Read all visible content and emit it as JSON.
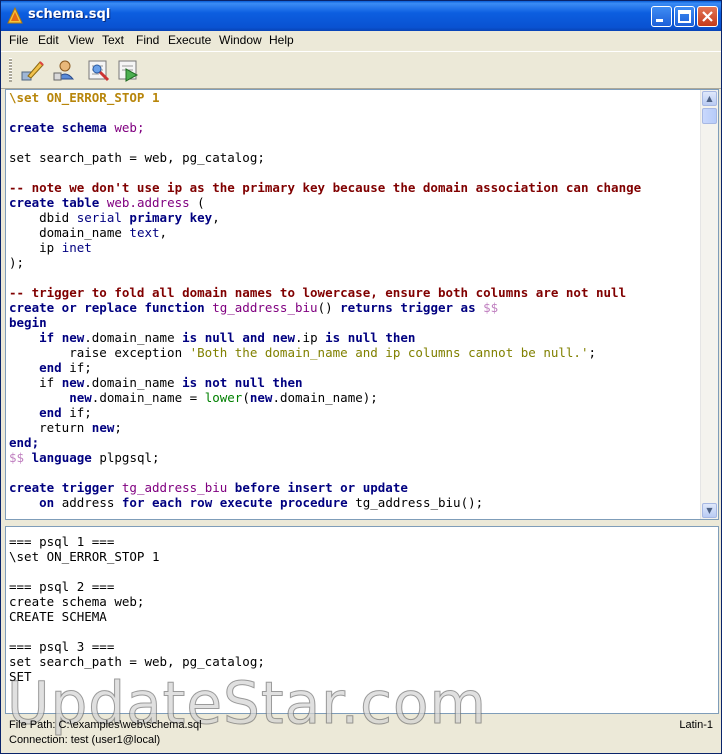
{
  "window": {
    "title": "schema.sql"
  },
  "menu": [
    "File",
    "Edit",
    "View",
    "Text",
    "Find",
    "Execute",
    "Window",
    "Help"
  ],
  "toolbar": {
    "icons": [
      "edit-pencil-icon",
      "connect-icon",
      "execute-icon",
      "execute-stop-icon"
    ]
  },
  "editor": {
    "lines": [
      [
        {
          "t": "\\set ON_ERROR_STOP 1",
          "c": "dir"
        }
      ],
      [],
      [
        {
          "t": "create",
          "c": "kw"
        },
        {
          "t": " "
        },
        {
          "t": "schema",
          "c": "kw"
        },
        {
          "t": " "
        },
        {
          "t": "web;",
          "c": "id"
        }
      ],
      [],
      [
        {
          "t": "set search_path = web, pg_catalog;"
        }
      ],
      [],
      [
        {
          "t": "-- note we don't use ip as the primary key because the domain association can change",
          "c": "cm"
        }
      ],
      [
        {
          "t": "create",
          "c": "kw"
        },
        {
          "t": " "
        },
        {
          "t": "table",
          "c": "kw"
        },
        {
          "t": " "
        },
        {
          "t": "web.address",
          "c": "id"
        },
        {
          "t": " ("
        }
      ],
      [
        {
          "t": "    dbid "
        },
        {
          "t": "serial",
          "c": "ty"
        },
        {
          "t": " "
        },
        {
          "t": "primary key",
          "c": "kw"
        },
        {
          "t": ","
        }
      ],
      [
        {
          "t": "    domain_name "
        },
        {
          "t": "text",
          "c": "ty"
        },
        {
          "t": ","
        }
      ],
      [
        {
          "t": "    ip "
        },
        {
          "t": "inet",
          "c": "ty"
        }
      ],
      [
        {
          "t": ");"
        }
      ],
      [],
      [
        {
          "t": "-- trigger to fold all domain names to lowercase, ensure both columns are not null",
          "c": "cm"
        }
      ],
      [
        {
          "t": "create or replace function",
          "c": "kw"
        },
        {
          "t": " "
        },
        {
          "t": "tg_address_biu",
          "c": "id"
        },
        {
          "t": "() "
        },
        {
          "t": "returns trigger as",
          "c": "kw"
        },
        {
          "t": " "
        },
        {
          "t": "$$",
          "c": "dol"
        }
      ],
      [
        {
          "t": "begin",
          "c": "kw"
        }
      ],
      [
        {
          "t": "    "
        },
        {
          "t": "if",
          "c": "kw"
        },
        {
          "t": " "
        },
        {
          "t": "new",
          "c": "kw"
        },
        {
          "t": ".domain_name "
        },
        {
          "t": "is null and",
          "c": "kw"
        },
        {
          "t": " "
        },
        {
          "t": "new",
          "c": "kw"
        },
        {
          "t": ".ip "
        },
        {
          "t": "is null then",
          "c": "kw"
        }
      ],
      [
        {
          "t": "        raise exception "
        },
        {
          "t": "'Both the domain_name and ip columns cannot be null.'",
          "c": "st"
        },
        {
          "t": ";"
        }
      ],
      [
        {
          "t": "    "
        },
        {
          "t": "end",
          "c": "kw"
        },
        {
          "t": " if;"
        }
      ],
      [
        {
          "t": "    if "
        },
        {
          "t": "new",
          "c": "kw"
        },
        {
          "t": ".domain_name "
        },
        {
          "t": "is not null then",
          "c": "kw"
        }
      ],
      [
        {
          "t": "        "
        },
        {
          "t": "new",
          "c": "kw"
        },
        {
          "t": ".domain_name = "
        },
        {
          "t": "lower",
          "c": "fn"
        },
        {
          "t": "("
        },
        {
          "t": "new",
          "c": "kw"
        },
        {
          "t": ".domain_name);"
        }
      ],
      [
        {
          "t": "    "
        },
        {
          "t": "end",
          "c": "kw"
        },
        {
          "t": " if;"
        }
      ],
      [
        {
          "t": "    return "
        },
        {
          "t": "new",
          "c": "kw"
        },
        {
          "t": ";"
        }
      ],
      [
        {
          "t": "end;",
          "c": "kw"
        }
      ],
      [
        {
          "t": "$$",
          "c": "dol"
        },
        {
          "t": " "
        },
        {
          "t": "language",
          "c": "kw"
        },
        {
          "t": " plpgsql;"
        }
      ],
      [],
      [
        {
          "t": "create",
          "c": "kw"
        },
        {
          "t": " "
        },
        {
          "t": "trigger",
          "c": "kw"
        },
        {
          "t": " "
        },
        {
          "t": "tg_address_biu",
          "c": "id"
        },
        {
          "t": " "
        },
        {
          "t": "before insert or update",
          "c": "kw"
        }
      ],
      [
        {
          "t": "    "
        },
        {
          "t": "on",
          "c": "kw"
        },
        {
          "t": " address "
        },
        {
          "t": "for each row execute procedure",
          "c": "kw"
        },
        {
          "t": " tg_address_biu();"
        }
      ]
    ]
  },
  "output": {
    "lines": [
      "=== psql 1 ===",
      "\\set ON_ERROR_STOP 1",
      "",
      "=== psql 2 ===",
      "create schema web;",
      "CREATE SCHEMA",
      "",
      "=== psql 3 ===",
      "set search_path = web, pg_catalog;",
      "SET"
    ]
  },
  "watermark": "UpdateStar.com",
  "status": {
    "file_path": "File Path: C:\\examples\\web\\schema.sql",
    "connection": "Connection: test (user1@local)",
    "encoding": "Latin-1"
  }
}
